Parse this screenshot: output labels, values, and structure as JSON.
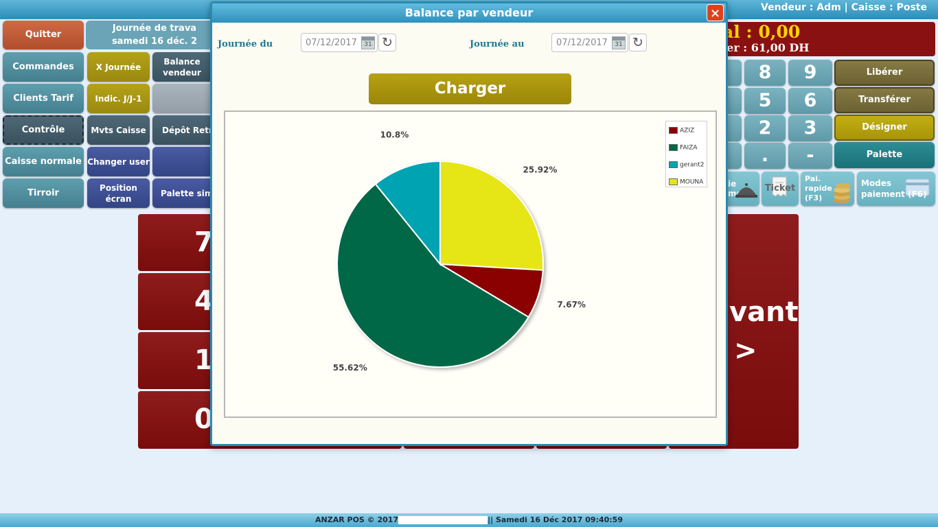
{
  "header": {
    "user_info": "Vendeur : Adm | Caisse : Poste"
  },
  "journee": {
    "line1": "Journée de trava",
    "line2": "samedi 16 déc. 2"
  },
  "left_buttons": {
    "quitter": "Quitter",
    "commandes": "Commandes",
    "clients_tarif": "Clients Tarif",
    "controle": "Contrôle",
    "caisse_normale": "Caisse normale",
    "tiroir": "Tirroir",
    "x_journee": "X Journée",
    "indic": "Indic. J/J-1",
    "mvts_caisse": "Mvts Caisse",
    "changer_user": "Changer user",
    "position_ecran": "Position écran",
    "balance_vendeur": "Balance vendeur",
    "depot_retrait": "Dépôt Retra",
    "palette_simple": "Palette simp"
  },
  "totals": {
    "total": "al : 0,00",
    "caissier": "ier : 61,00 DH"
  },
  "keypad": {
    "k8": "8",
    "k9": "9",
    "k5": "5",
    "k6": "6",
    "k2": "2",
    "k3": "3",
    "kdot": ".",
    "kminus": "-"
  },
  "right_buttons": {
    "liberer": "Libérer",
    "transferer": "Transférer",
    "designer": "Désigner",
    "palette": "Palette"
  },
  "bottom_icons": {
    "sortie": "ie",
    "sortie2": "me",
    "ticket": "Ticket",
    "pai_rapide": "Pai. rapide (F3)",
    "modes_paiement": "Modes paiement (F6)"
  },
  "big_panel": {
    "n7": "7",
    "n4": "4",
    "n1": "1",
    "n0": "0",
    "suivant": "vant",
    "arrow": ">"
  },
  "modal": {
    "title": "Balance par vendeur",
    "close": "×",
    "label_from": "Journée du",
    "label_to": "Journée au",
    "date_from": "07/12/2017",
    "date_to": "07/12/2017",
    "calendar_day": "31",
    "charger": "Charger"
  },
  "chart_data": {
    "type": "pie",
    "categories": [
      "AZIZ",
      "FAIZA",
      "gerant2",
      "MOUNA"
    ],
    "values": [
      7.67,
      55.62,
      10.8,
      25.92
    ],
    "labels": [
      "7.67%",
      "55.62%",
      "10.8%",
      "25.92%"
    ],
    "colors": [
      "#8b0000",
      "#006847",
      "#00a3b2",
      "#e6e619"
    ],
    "legend": "top-right"
  },
  "footer": {
    "left": "ANZAR POS © 2017",
    "right": "|| Samedi 16 Déc 2017 09:40:59"
  }
}
